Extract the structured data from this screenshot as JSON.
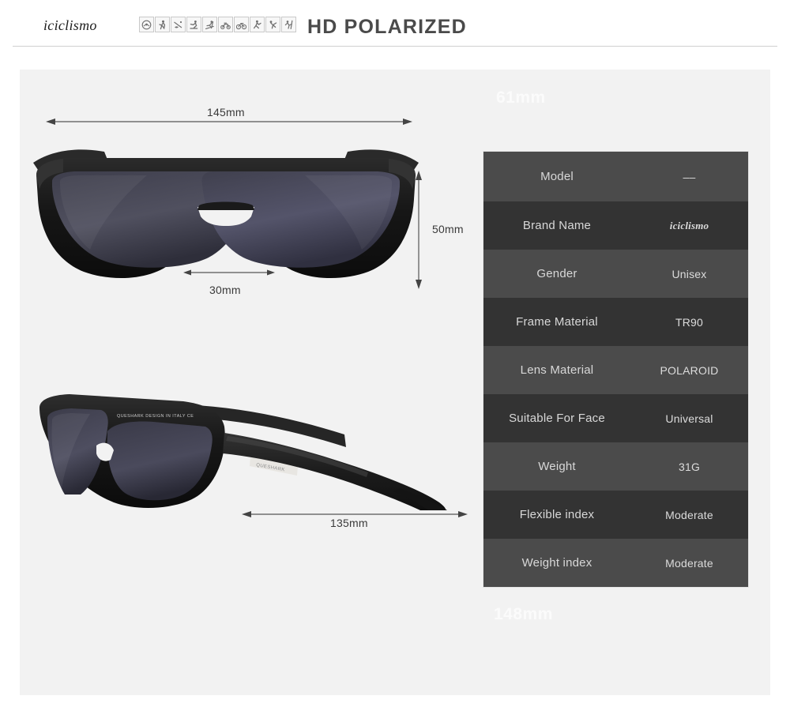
{
  "header": {
    "brand": "iciclismo",
    "title": "HD POLARIZED",
    "icons": [
      {
        "name": "no-glare-icon",
        "label": "anti-glare"
      },
      {
        "name": "running-icon",
        "label": "running"
      },
      {
        "name": "fishing-icon",
        "label": "fishing"
      },
      {
        "name": "skating-icon",
        "label": "skating"
      },
      {
        "name": "skiing-icon",
        "label": "skiing"
      },
      {
        "name": "motorcycling-icon",
        "label": "motorcycling"
      },
      {
        "name": "cycling-icon",
        "label": "cycling"
      },
      {
        "name": "golf-icon",
        "label": "golf"
      },
      {
        "name": "baseball-icon",
        "label": "baseball"
      },
      {
        "name": "climbing-icon",
        "label": "climbing"
      }
    ]
  },
  "watermarks": {
    "top": "61mm",
    "bottom": "148mm"
  },
  "dimensions": {
    "total_width": "145mm",
    "lens_height": "50mm",
    "bridge_width": "30mm",
    "temple_length": "135mm"
  },
  "product": {
    "temple_print": "QUESHARK DESIGN IN ITALY CE",
    "hinge_plate": "QUESHARK"
  },
  "spec_table": {
    "rows": [
      {
        "key": "Model",
        "value": "––"
      },
      {
        "key": "Brand Name",
        "value": "iciclismo"
      },
      {
        "key": "Gender",
        "value": "Unisex"
      },
      {
        "key": "Frame Material",
        "value": "TR90"
      },
      {
        "key": "Lens Material",
        "value": "POLAROID"
      },
      {
        "key": "Suitable For Face",
        "value": "Universal"
      },
      {
        "key": "Weight",
        "value": "31G"
      },
      {
        "key": "Flexible index",
        "value": "Moderate"
      },
      {
        "key": "Weight index",
        "value": "Moderate"
      }
    ]
  },
  "colors": {
    "panel_bg": "#f2f2f2",
    "row_light": "#4b4b4b",
    "row_dark": "#333333",
    "title": "#4a4a4a",
    "frame": "#1a1a1a",
    "lens": "#4a4a58"
  }
}
